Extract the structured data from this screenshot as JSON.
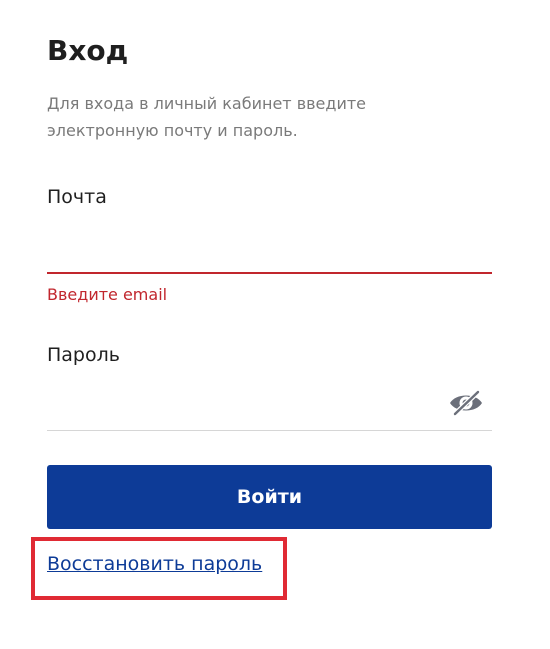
{
  "title": "Вход",
  "subtitle": "Для входа в личный кабинет введите электронную почту и пароль.",
  "email": {
    "label": "Почта",
    "value": "",
    "error": "Введите email"
  },
  "password": {
    "label": "Пароль",
    "value": "",
    "toggle_icon": "eye-slash-icon"
  },
  "submit_label": "Войти",
  "restore_password_link": "Восстановить пароль",
  "colors": {
    "accent": "#0d3b97",
    "error": "#c1262d",
    "highlight": "#e02a34",
    "muted_text": "#7a7a7a",
    "icon": "#6b6f7a"
  }
}
